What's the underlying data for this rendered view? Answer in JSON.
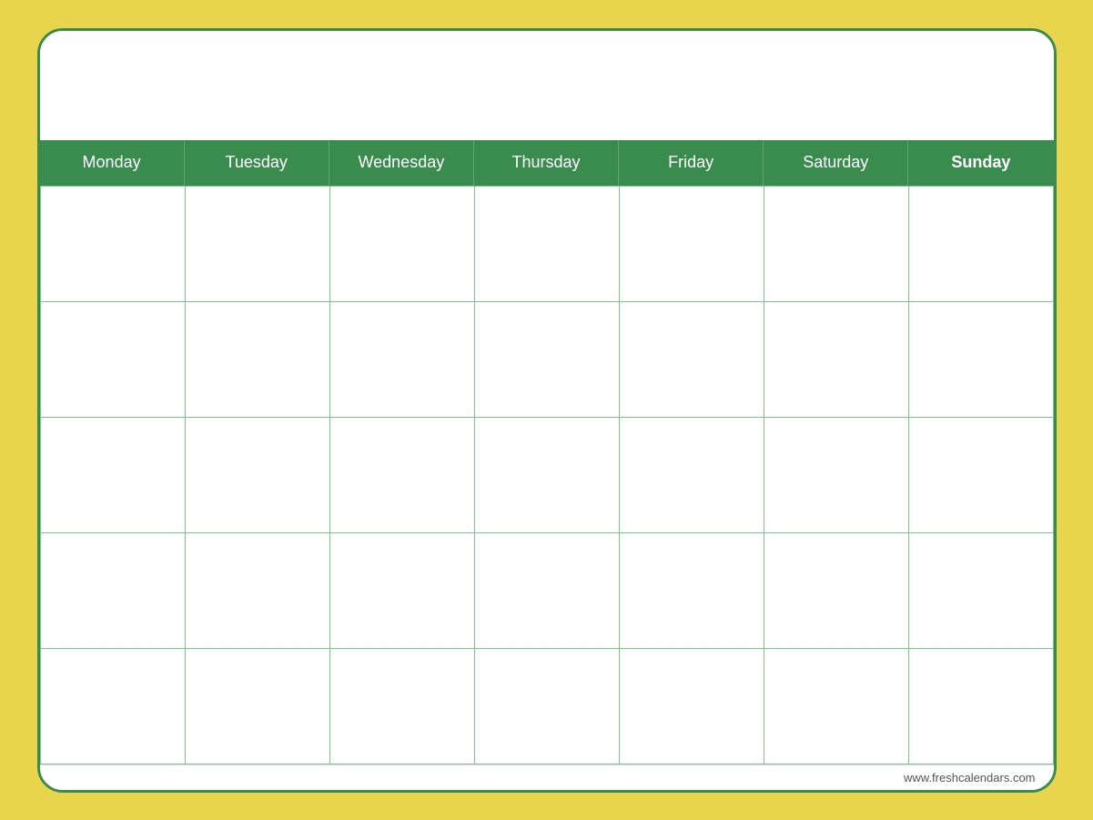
{
  "calendar": {
    "background_color": "#e8d44d",
    "border_color": "#3a8c4e",
    "days": [
      {
        "label": "Monday",
        "bold": false
      },
      {
        "label": "Tuesday",
        "bold": false
      },
      {
        "label": "Wednesday",
        "bold": false
      },
      {
        "label": "Thursday",
        "bold": false
      },
      {
        "label": "Friday",
        "bold": false
      },
      {
        "label": "Saturday",
        "bold": false
      },
      {
        "label": "Sunday",
        "bold": true
      }
    ],
    "rows": 5,
    "cols": 7,
    "footer_url": "www.freshcalendars.com",
    "watermark": "freshcalendars.com"
  }
}
